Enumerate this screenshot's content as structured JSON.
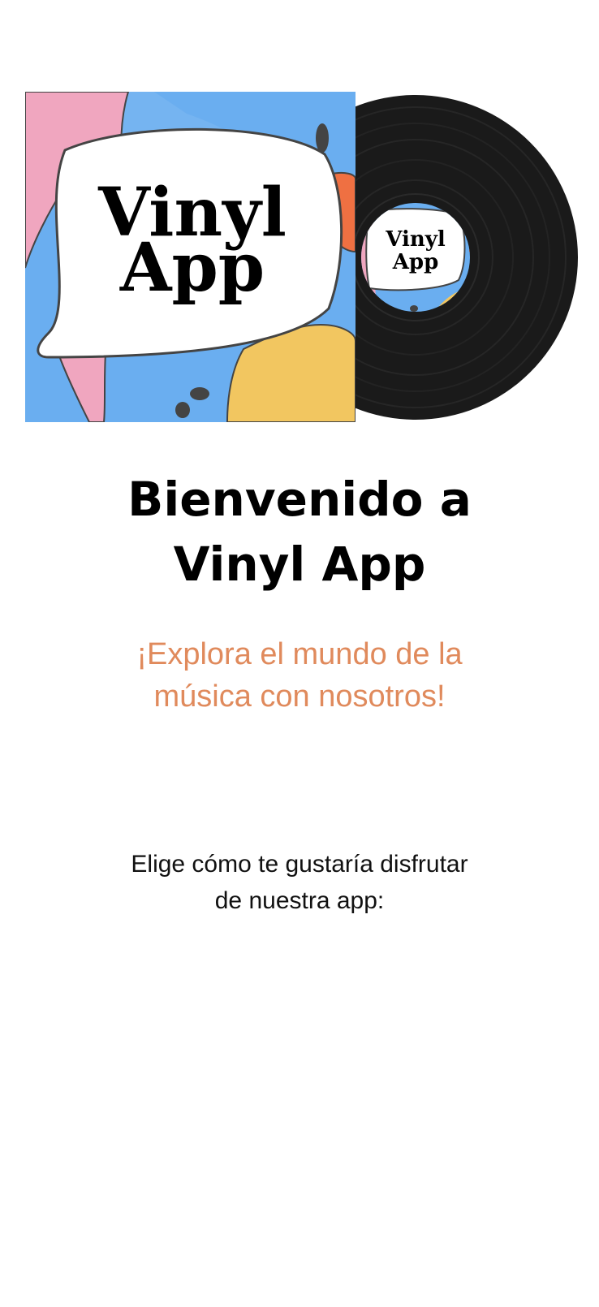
{
  "hero": {
    "cover_text_line1": "Vinyl",
    "cover_text_line2": "App",
    "label_text_line1": "Vinyl",
    "label_text_line2": "App"
  },
  "welcome": {
    "title_line1": "Bienvenido a",
    "title_line2": "Vinyl App",
    "subtitle_line1": "¡Explora el mundo de la",
    "subtitle_line2": "música con nosotros!",
    "prompt_line1": "Elige cómo te gustaría disfrutar",
    "prompt_line2": "de nuestra app:"
  },
  "colors": {
    "subtitle": "#e08a5c",
    "cover_blue": "#6aaef0",
    "cover_pink": "#f0a6bf",
    "cover_yellow": "#f2c660",
    "cover_orange": "#ef7042",
    "record_black": "#1a1a1a"
  }
}
